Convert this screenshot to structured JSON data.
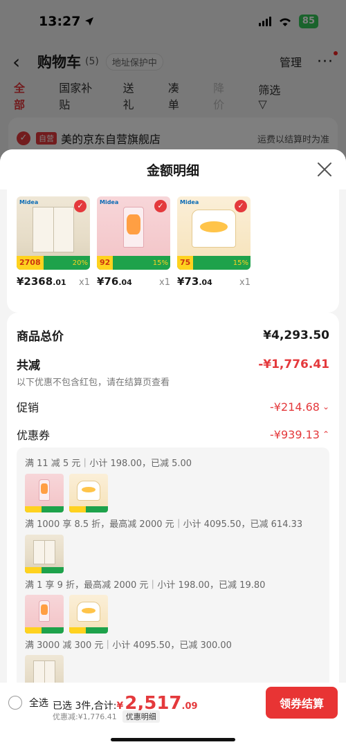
{
  "status": {
    "time": "13:27",
    "battery": "85"
  },
  "nav": {
    "title": "购物车",
    "count": "(5)",
    "address": "地址保护中",
    "manage": "管理",
    "more": "···"
  },
  "tabs": [
    "全部",
    "国家补贴",
    "送礼",
    "凑单",
    "降价",
    "筛选"
  ],
  "store": {
    "tag": "自营",
    "name": "美的京东自营旗舰店",
    "freight": "运费以结算时为准"
  },
  "sheet": {
    "title": "金额明细",
    "products": [
      {
        "price_int": "¥2368",
        "price_dec": ".01",
        "qty": "x1",
        "band_price": "2708",
        "band_pct": "20%",
        "icon": "fridge"
      },
      {
        "price_int": "¥76",
        "price_dec": ".04",
        "qty": "x1",
        "band_price": "92",
        "band_pct": "15%",
        "icon": "blender"
      },
      {
        "price_int": "¥73",
        "price_dec": ".04",
        "qty": "x1",
        "band_price": "75",
        "band_pct": "15%",
        "icon": "steamer"
      }
    ],
    "rows": {
      "total_label": "商品总价",
      "total_value": "¥4,293.50",
      "reduce_label": "共减",
      "reduce_value": "-¥1,776.41",
      "reduce_note": "以下优惠不包含红包，请在结算页查看",
      "promo_label": "促销",
      "promo_value": "-¥214.68",
      "coupon_label": "优惠券",
      "coupon_value": "-¥939.13"
    },
    "coupons": [
      "满 11 减 5 元｜小计 198.00，已减 5.00",
      "满 1000 享 8.5 折，最高减 2000 元｜小计 4095.50，已减 614.33",
      "满 1 享 9 折，最高减 2000 元｜小计 198.00，已减 19.80",
      "满 3000 减 300 元｜小计 4095.50，已减 300.00"
    ]
  },
  "bottom": {
    "select_all": "全选",
    "selected": "已选 3件,合计:",
    "currency": "¥",
    "total_int": "2,517",
    "total_dec": ".09",
    "discount": "优惠减:¥1,776.41",
    "detail_link": "优惠明细",
    "checkout": "领券结算"
  },
  "colors": {
    "accent": "#e4393c",
    "band": "#1ea24b",
    "tag": "#ffd21f"
  }
}
